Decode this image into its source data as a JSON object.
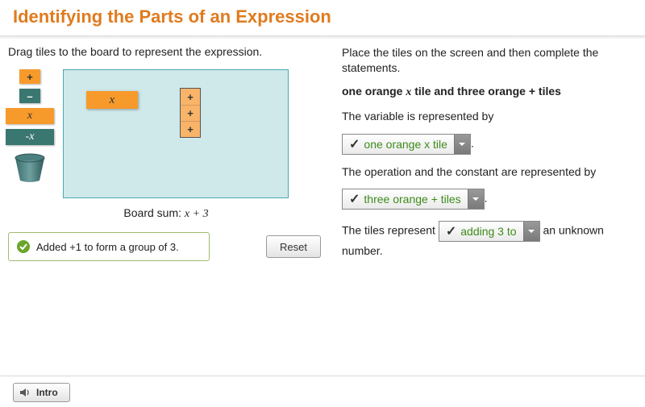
{
  "title": "Identifying the Parts of an Expression",
  "left": {
    "instruction": "Drag tiles to the board to represent the expression.",
    "palette": {
      "plus": "+",
      "minus": "–",
      "x": "x",
      "negx": "-x"
    },
    "boardSumLabel": "Board sum: ",
    "boardSumExpr": "x + 3",
    "feedback": "Added +1 to form a group of 3.",
    "resetLabel": "Reset"
  },
  "right": {
    "instruction": "Place the tiles on the screen and then complete the statements.",
    "bold_before": "one orange ",
    "bold_it": "x",
    "bold_after": " tile and three orange + tiles",
    "line1": "The variable is represented by",
    "select1": "one orange x tile",
    "line2": "The operation and the constant are represented by",
    "select2": "three orange + tiles",
    "line3_before": "The tiles represent ",
    "select3": "adding 3 to",
    "line3_after": " an unknown number."
  },
  "footer": {
    "intro": "Intro"
  }
}
